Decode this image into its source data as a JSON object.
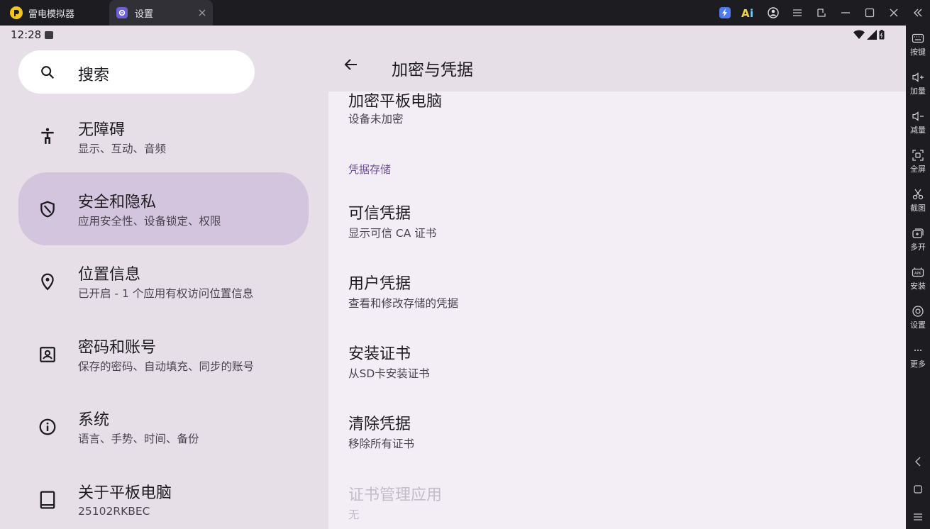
{
  "titlebar": {
    "app_tab_label": "雷电模拟器",
    "active_tab_label": "设置"
  },
  "statusbar": {
    "time": "12:28"
  },
  "search": {
    "placeholder": "搜索"
  },
  "sidebar": {
    "items": [
      {
        "title": "无障碍",
        "subtitle": "显示、互动、音频",
        "icon": "accessibility-icon"
      },
      {
        "title": "安全和隐私",
        "subtitle": "应用安全性、设备锁定、权限",
        "icon": "shield-icon",
        "active": true
      },
      {
        "title": "位置信息",
        "subtitle": "已开启 - 1 个应用有权访问位置信息",
        "icon": "location-pin-icon"
      },
      {
        "title": "密码和账号",
        "subtitle": "保存的密码、自动填充、同步的账号",
        "icon": "account-box-icon"
      },
      {
        "title": "系统",
        "subtitle": "语言、手势、时间、备份",
        "icon": "info-icon"
      },
      {
        "title": "关于平板电脑",
        "subtitle": "25102RKBEC",
        "icon": "tablet-icon"
      }
    ]
  },
  "page": {
    "title": "加密与凭据",
    "encrypt": {
      "title": "加密平板电脑",
      "subtitle": "设备未加密"
    },
    "category": "凭据存储",
    "prefs": [
      {
        "title": "可信凭据",
        "subtitle": "显示可信 CA 证书"
      },
      {
        "title": "用户凭据",
        "subtitle": "查看和修改存储的凭据"
      },
      {
        "title": "安装证书",
        "subtitle": "从SD卡安装证书"
      },
      {
        "title": "清除凭据",
        "subtitle": "移除所有证书"
      },
      {
        "title": "证书管理应用",
        "subtitle": "无",
        "disabled": true
      }
    ]
  },
  "toolbar": {
    "items": [
      "按键",
      "加量",
      "减量",
      "全屏",
      "截图",
      "多开",
      "安装",
      "设置",
      "更多"
    ]
  },
  "colors": {
    "active_item_bg": "#d4c5de",
    "category_header": "#6b4f98",
    "pane_bg": "#e6dfe8"
  }
}
